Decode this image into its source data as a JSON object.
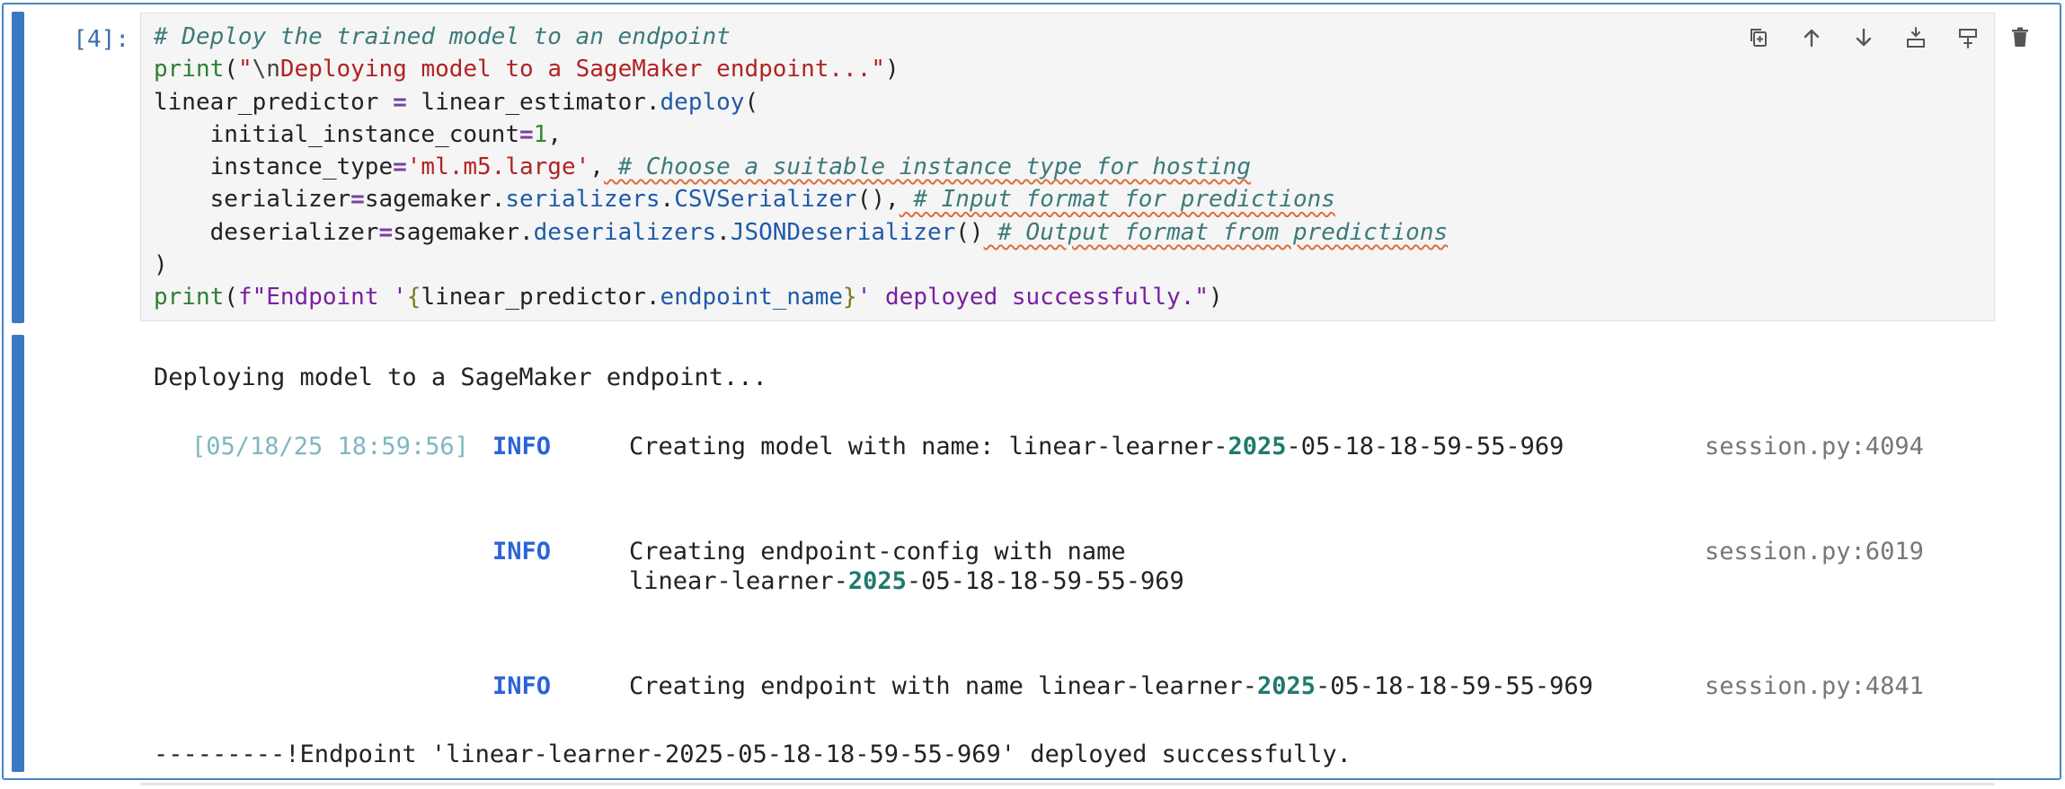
{
  "cell": {
    "prompt": "[4]:",
    "code_lines": [
      {
        "parts": [
          [
            "cm",
            "# Deploy the trained model to an endpoint"
          ]
        ]
      },
      {
        "parts": [
          [
            "kw-b",
            "print"
          ],
          [
            "",
            "("
          ],
          [
            "str",
            "\""
          ],
          [
            "esc",
            "\\n"
          ],
          [
            "str",
            "Deploying model to a SageMaker endpoint...\""
          ],
          [
            "",
            ")"
          ]
        ]
      },
      {
        "parts": [
          [
            "",
            "linear_predictor "
          ],
          [
            "op",
            "="
          ],
          [
            "",
            " linear_estimator."
          ],
          [
            "attr",
            "deploy"
          ],
          [
            "",
            "("
          ]
        ]
      },
      {
        "parts": [
          [
            "",
            "    initial_instance_count"
          ],
          [
            "op",
            "="
          ],
          [
            "num",
            "1"
          ],
          [
            "",
            ","
          ]
        ]
      },
      {
        "parts": [
          [
            "",
            "    instance_type"
          ],
          [
            "op",
            "="
          ],
          [
            "str",
            "'ml.m5.large'"
          ],
          [
            "",
            ","
          ],
          [
            "cm wavy",
            " # Choose a suitable instance type for hosting"
          ]
        ]
      },
      {
        "parts": [
          [
            "",
            "    serializer"
          ],
          [
            "op",
            "="
          ],
          [
            "",
            "sagemaker."
          ],
          [
            "attr",
            "serializers"
          ],
          [
            "",
            "."
          ],
          [
            "attr",
            "CSVSerializer"
          ],
          [
            "",
            "(),"
          ],
          [
            "cm wavy",
            " # Input format for predictions"
          ]
        ]
      },
      {
        "parts": [
          [
            "",
            "    deserializer"
          ],
          [
            "op",
            "="
          ],
          [
            "",
            "sagemaker."
          ],
          [
            "attr",
            "deserializers"
          ],
          [
            "",
            "."
          ],
          [
            "attr",
            "JSONDeserializer"
          ],
          [
            "",
            "()"
          ],
          [
            "cm wavy",
            " # Output format from predictions"
          ]
        ]
      },
      {
        "parts": [
          [
            "",
            ")"
          ]
        ]
      },
      {
        "parts": [
          [
            "kw-b",
            "print"
          ],
          [
            "",
            "("
          ],
          [
            "fstr",
            "f\"Endpoint '"
          ],
          [
            "brace",
            "{"
          ],
          [
            "",
            "linear_predictor."
          ],
          [
            "attr",
            "endpoint_name"
          ],
          [
            "brace",
            "}"
          ],
          [
            "fstr",
            "' deployed successfully.\""
          ],
          [
            "",
            ")"
          ]
        ]
      }
    ]
  },
  "toolbar": [
    {
      "name": "duplicate-cell-icon",
      "title": "Duplicate"
    },
    {
      "name": "move-up-icon",
      "title": "Move up"
    },
    {
      "name": "move-down-icon",
      "title": "Move down"
    },
    {
      "name": "insert-above-icon",
      "title": "Insert above"
    },
    {
      "name": "insert-below-icon",
      "title": "Insert below"
    },
    {
      "name": "delete-cell-icon",
      "title": "Delete"
    }
  ],
  "output": {
    "line1": "Deploying model to a SageMaker endpoint...",
    "log": [
      {
        "timestamp": "[05/18/25 18:59:56]",
        "level": "INFO",
        "msg_a": "Creating model with name: linear-learner-",
        "year": "2025",
        "msg_b": "-05-18-18-59-55-969",
        "msg_line2": "",
        "source": "session.py:4094"
      },
      {
        "timestamp": "",
        "level": "INFO",
        "msg_a": "Creating endpoint-config with name",
        "year": "",
        "msg_b": "",
        "msg_line2_a": "linear-learner-",
        "msg_line2_year": "2025",
        "msg_line2_b": "-05-18-18-59-55-969",
        "source": "session.py:6019"
      },
      {
        "timestamp": "",
        "level": "INFO",
        "msg_a": "Creating endpoint with name linear-learner-",
        "year": "2025",
        "msg_b": "-05-18-18-59-55-969",
        "msg_line2": "",
        "source": "session.py:4841"
      }
    ],
    "final": "---------!Endpoint 'linear-learner-2025-05-18-18-59-55-969' deployed successfully."
  }
}
